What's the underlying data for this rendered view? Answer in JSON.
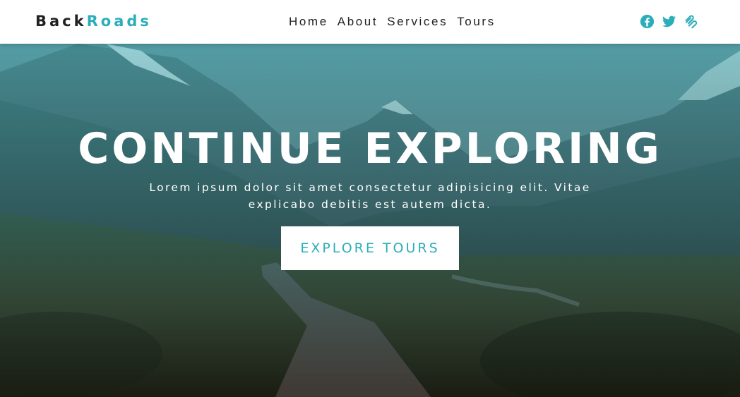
{
  "brand": {
    "part1": "Back",
    "part2": "Roads"
  },
  "nav": {
    "links": [
      "Home",
      "About",
      "Services",
      "Tours"
    ]
  },
  "social": {
    "icons": [
      "facebook-icon",
      "twitter-icon",
      "squarespace-icon"
    ]
  },
  "hero": {
    "title": "CONTINUE EXPLORING",
    "text": "Lorem ipsum dolor sit amet consectetur adipisicing elit. Vitae explicabo debitis est autem dicta.",
    "button_label": "EXPLORE TOURS"
  },
  "colors": {
    "accent": "#2caeba",
    "text_dark": "#222222",
    "white": "#ffffff"
  }
}
